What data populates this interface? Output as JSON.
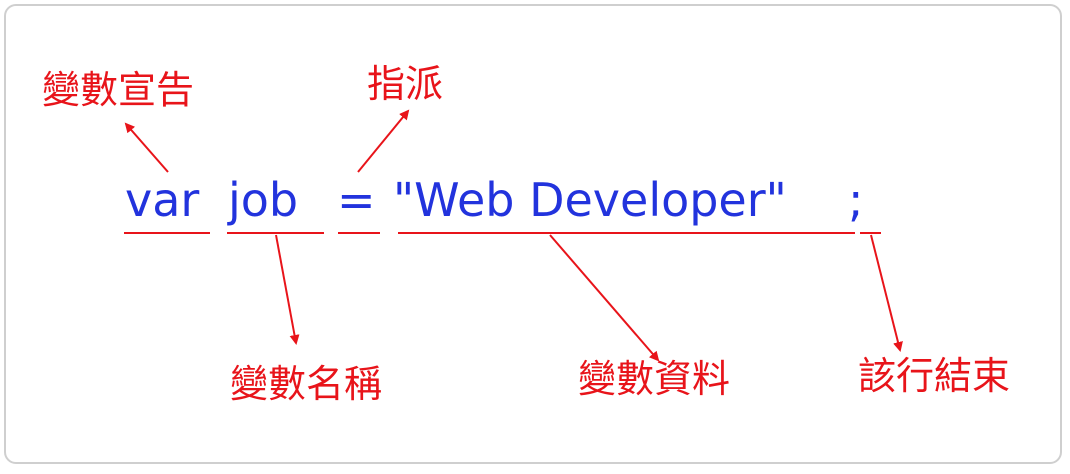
{
  "code": {
    "keyword": "var",
    "name": "job",
    "operator": "=",
    "value": "\"Web Developer\"",
    "terminator": ";"
  },
  "labels": {
    "declaration": "變數宣告",
    "assignment": "指派",
    "variable_name": "變數名稱",
    "variable_data": "變數資料",
    "line_end": "該行結束"
  },
  "colors": {
    "code_text": "#2233dd",
    "annotation": "#e8141a",
    "frame_border": "#cfcfcf"
  }
}
